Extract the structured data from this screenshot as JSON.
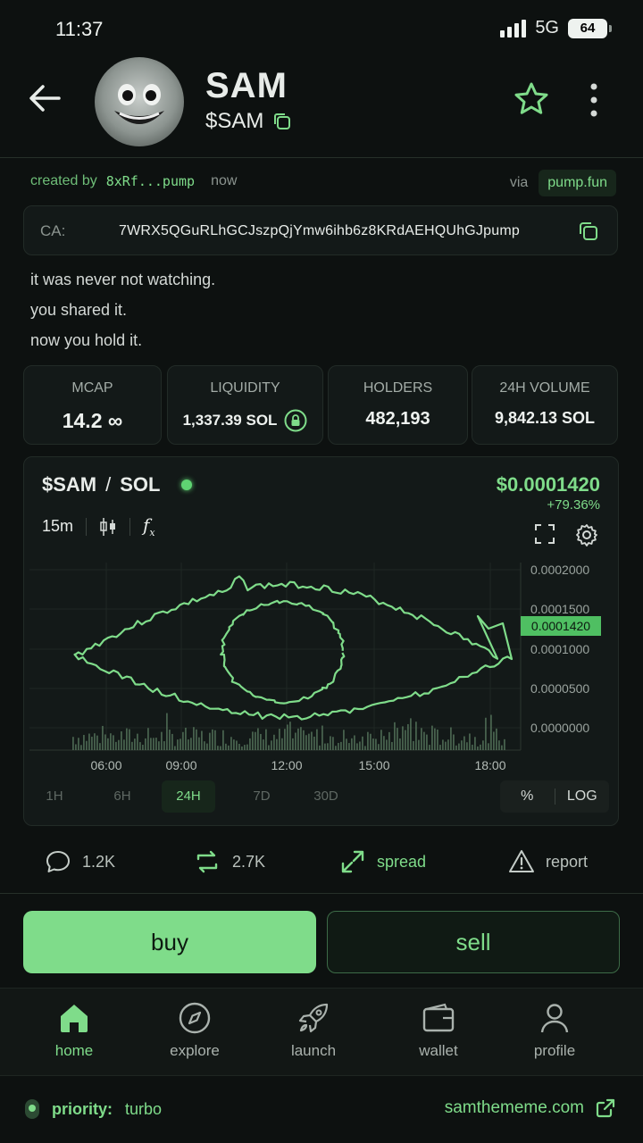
{
  "status_bar": {
    "time": "11:37",
    "network": "5G",
    "battery": "64"
  },
  "header": {
    "title": "SAM",
    "ticker": "$SAM"
  },
  "meta": {
    "created_by_label": "created by",
    "creator": "8xRf...pump",
    "time_ago": "now",
    "via_label": "via",
    "platform": "pump.fun"
  },
  "contract": {
    "label": "CA:",
    "address": "7WRX5QGuRLhGCJszpQjYmw6ihb6z8KRdAEHQUhGJpump"
  },
  "description": [
    "it was never not watching.",
    "you shared it.",
    "now you hold it."
  ],
  "stats": [
    {
      "label": "MCAP",
      "value": "14.2 ∞"
    },
    {
      "label": "LIQUIDITY",
      "value": "1,337.39 SOL",
      "icon": "lock-icon"
    },
    {
      "label": "HOLDERS",
      "value": "482,193"
    },
    {
      "label": "24H VOLUME",
      "value": "9,842.13 SOL"
    }
  ],
  "chart": {
    "pair": "$SAM",
    "pair_sep": "/",
    "quote": "SOL",
    "price": "$0.0001420",
    "change": "+79.36%",
    "interval": "15m",
    "fx_label": "f",
    "ranges": [
      "1H",
      "6H",
      "24H",
      "7D",
      "30D"
    ],
    "active_range": "24H",
    "scale_options": [
      "%",
      "LOG"
    ],
    "colors": {
      "line": "#7fdc8a",
      "volume": "#5a7a5f",
      "grid": "#1f2824"
    }
  },
  "chart_data": {
    "type": "line",
    "x_ticks": [
      "06:00",
      "09:00",
      "12:00",
      "15:00",
      "18:00"
    ],
    "y_ticks": [
      "0.0002000",
      "0.0001500",
      "0.0001000",
      "0.0000500",
      "0.0000000"
    ],
    "ylim": [
      0,
      0.0002
    ],
    "current_price_label": "0.0001420",
    "series": [
      {
        "values": [
          9.5e-05,
          0.00011,
          0.000125,
          0.000145,
          0.000155,
          0.00016,
          0.000152,
          0.000148,
          0.000145,
          0.00014,
          0.000142
        ]
      }
    ]
  },
  "social": {
    "comments": "1.2K",
    "reposts": "2.7K",
    "spread": "spread",
    "report": "report"
  },
  "trade": {
    "buy": "buy",
    "sell": "sell"
  },
  "nav": [
    {
      "label": "home",
      "icon": "home-icon"
    },
    {
      "label": "explore",
      "icon": "compass-icon"
    },
    {
      "label": "launch",
      "icon": "rocket-icon"
    },
    {
      "label": "wallet",
      "icon": "wallet-icon"
    },
    {
      "label": "profile",
      "icon": "user-icon"
    }
  ],
  "footer": {
    "priority_label": "priority:",
    "priority_value": "turbo",
    "site": "samthememe.com"
  }
}
